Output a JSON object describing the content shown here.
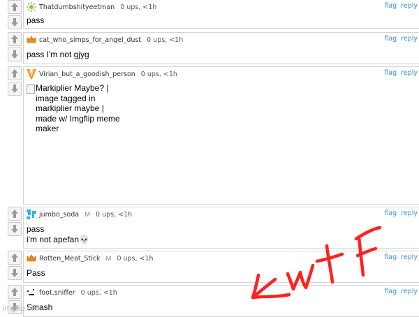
{
  "actions": {
    "flag": "flag",
    "reply": "reply"
  },
  "comments": [
    {
      "username": "Thatdumbshityeetman",
      "mod": "",
      "meta": "0 ups, <1h",
      "lines": [
        "pass"
      ]
    },
    {
      "username": "cat_who_simps_for_angel_dust",
      "mod": "",
      "meta": "0 ups, <1h",
      "lines": [
        "pass I'm not gjyg"
      ]
    },
    {
      "username": "Virian_but_a_goodish_person",
      "mod": "",
      "meta": "0 ups, <1h",
      "image_alt": "Markiplier Maybe? | image tagged in markiplier maybe | made w/ Imgflip meme maker"
    },
    {
      "username": "jumbo_soda",
      "mod": "M",
      "meta": "0 ups, <1h",
      "lines": [
        "pass",
        "i'm not apefan💀"
      ]
    },
    {
      "username": "Rotten_Meat_Stick",
      "mod": "M",
      "meta": "0 ups, <1h",
      "lines": [
        "Pass"
      ]
    },
    {
      "username": "foot.sniffer",
      "mod": "",
      "meta": "0 ups, <1h",
      "lines": [
        "Smash"
      ]
    }
  ],
  "watermark": "imgflip.com",
  "annotation": {
    "text": "←wtF",
    "color": "#ff2020"
  }
}
